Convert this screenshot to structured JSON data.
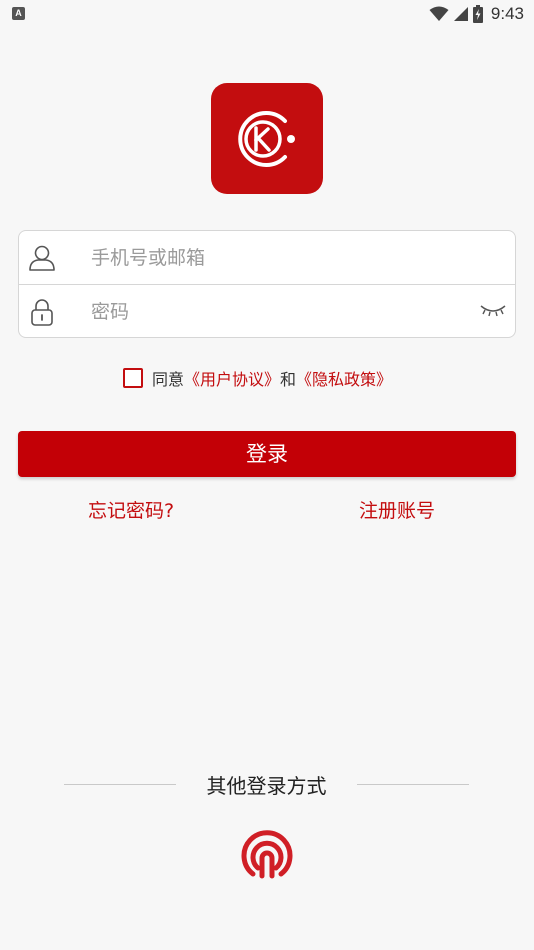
{
  "status_bar": {
    "notification_badge": "A",
    "time": "9:43",
    "icons": [
      "wifi-icon",
      "cellular-signal-icon",
      "battery-charging-icon"
    ]
  },
  "logo": {
    "icon": "app-logo-icon",
    "color": "#c30d0f"
  },
  "form": {
    "account_placeholder": "手机号或邮箱",
    "account_value": "",
    "password_placeholder": "密码",
    "password_value": ""
  },
  "agreement": {
    "checked": false,
    "prefix": "同意",
    "user_agreement": "《用户协议》",
    "conjunction": "和",
    "privacy_policy": "《隐私政策》"
  },
  "login_button": "登录",
  "links": {
    "forgot_password": "忘记密码?",
    "register": "注册账号"
  },
  "other_login": {
    "title": "其他登录方式",
    "icon": "other-login-icon"
  },
  "colors": {
    "accent": "#c30d0f",
    "background": "#f7f7f7"
  }
}
